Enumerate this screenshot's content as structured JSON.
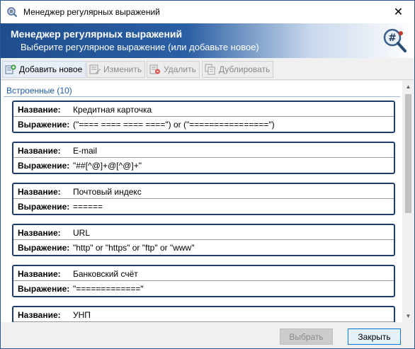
{
  "window": {
    "title": "Менеджер регулярных выражений",
    "close_glyph": "✕"
  },
  "banner": {
    "title": "Менеджер регулярных выражений",
    "subtitle": "Выберите регулярное выражение (или добавьте новое)",
    "icon": "regex-search-icon"
  },
  "toolbar": {
    "add": "Добавить новое",
    "edit": "Изменить",
    "delete": "Удалить",
    "duplicate": "Дублировать"
  },
  "group": {
    "label": "Встроенные  (10)"
  },
  "labels": {
    "name": "Название:",
    "expr": "Выражение:"
  },
  "items": [
    {
      "name": "Кредитная карточка",
      "expr": "(\"==== ==== ==== ====\") or (\"================\")"
    },
    {
      "name": "E-mail",
      "expr": "\"##[^@]+@[^@]+\""
    },
    {
      "name": "Почтовый индекс",
      "expr": "======"
    },
    {
      "name": "URL",
      "expr": "\"http\" or \"https\" or \"ftp\" or \"www\""
    },
    {
      "name": "Банковский счёт",
      "expr": "\"=============\""
    },
    {
      "name": "УНП",
      "expr": ""
    }
  ],
  "footer": {
    "select": "Выбрать",
    "close": "Закрыть"
  },
  "colors": {
    "accent": "#1f4e8f",
    "group_text": "#1f5aa8",
    "card_border": "#1f3d6b"
  }
}
